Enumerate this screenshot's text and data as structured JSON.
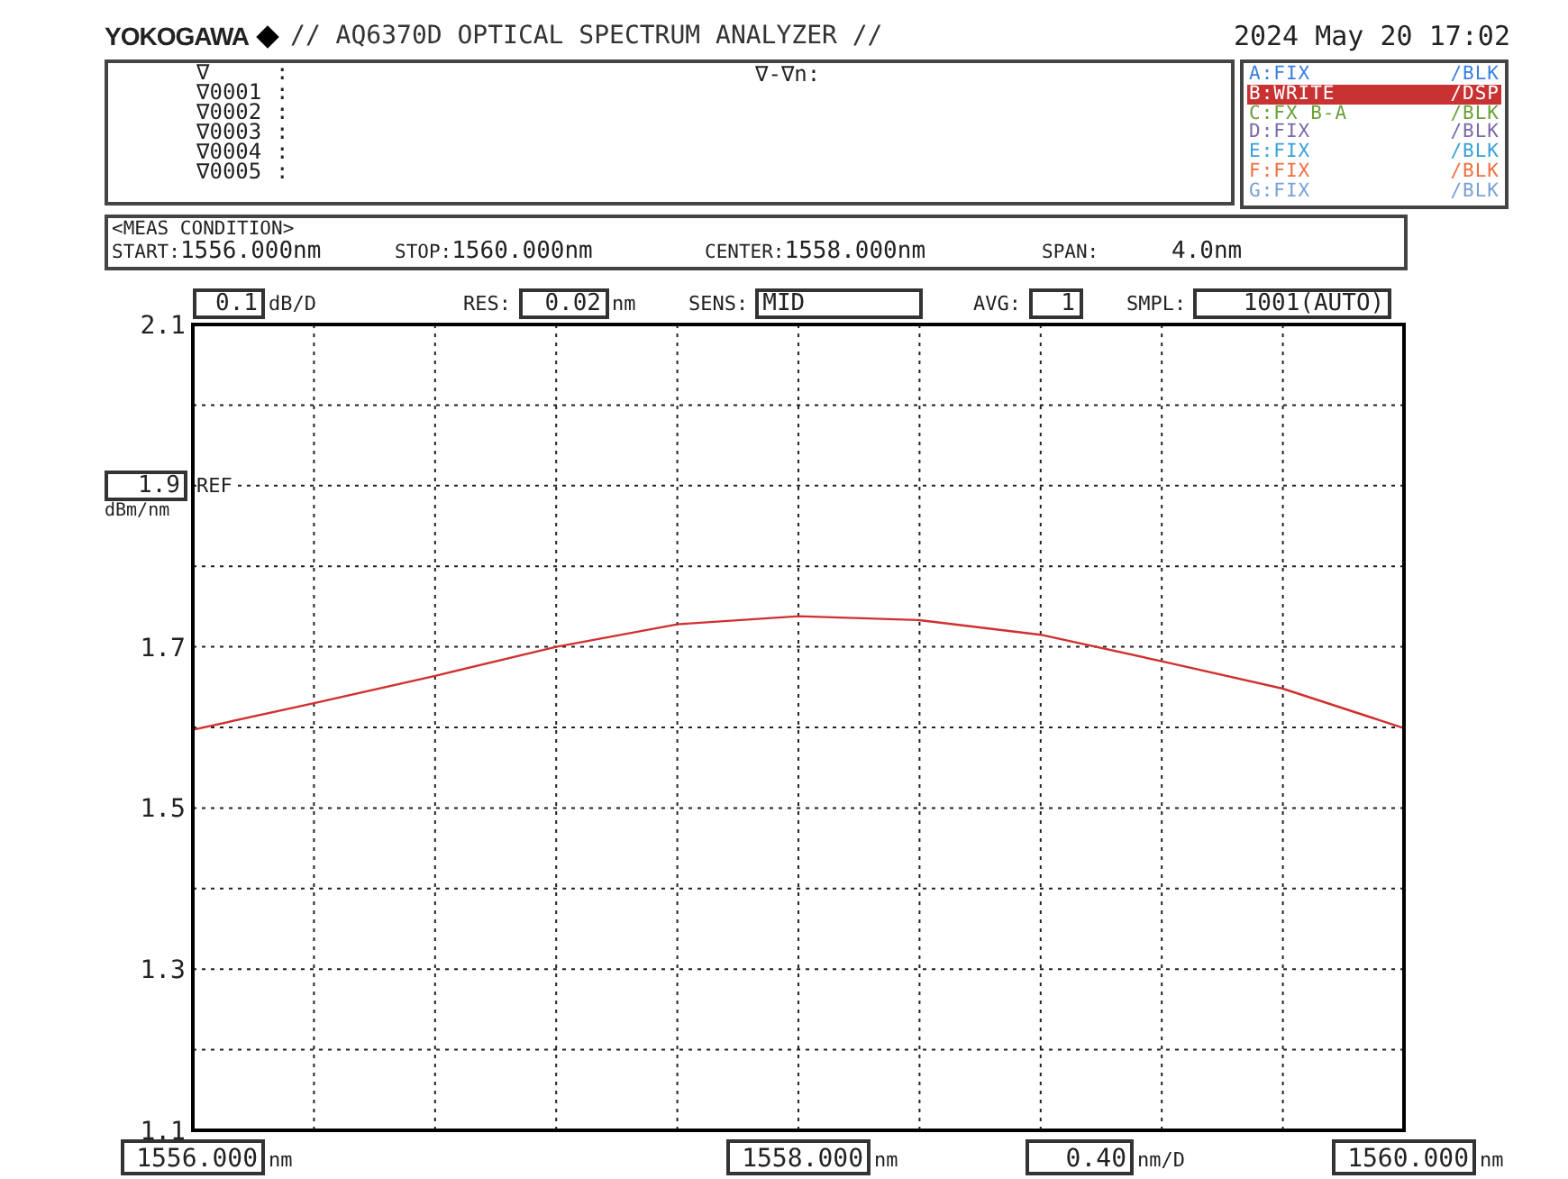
{
  "header": {
    "brand": "YOKOGAWA",
    "title": "// AQ6370D OPTICAL SPECTRUM ANALYZER //",
    "datetime": "2024 May 20 17:02"
  },
  "markers": [
    {
      "label": "∇",
      "sep": ":"
    },
    {
      "label": "∇0001",
      "sep": ":"
    },
    {
      "label": "∇0002",
      "sep": ":"
    },
    {
      "label": "∇0003",
      "sep": ":"
    },
    {
      "label": "∇0004",
      "sep": ":"
    },
    {
      "label": "∇0005",
      "sep": ":"
    }
  ],
  "delta_label": "∇-∇n:",
  "traces": [
    {
      "label": "A:FIX",
      "mode": "/BLK",
      "color": "#3a7fe0",
      "selected": false
    },
    {
      "label": "B:WRITE",
      "mode": "/DSP",
      "color": "#c83232",
      "selected": true
    },
    {
      "label": "C:FX B-A",
      "mode": "/BLK",
      "color": "#6aa03a",
      "selected": false
    },
    {
      "label": "D:FIX",
      "mode": "/BLK",
      "color": "#7a6aa8",
      "selected": false
    },
    {
      "label": "E:FIX",
      "mode": "/BLK",
      "color": "#3aa0d8",
      "selected": false
    },
    {
      "label": "F:FIX",
      "mode": "/BLK",
      "color": "#f07040",
      "selected": false
    },
    {
      "label": "G:FIX",
      "mode": "/BLK",
      "color": "#7aa0d8",
      "selected": false
    }
  ],
  "meas_condition": {
    "title": "<MEAS CONDITION>",
    "fields": [
      {
        "label": "START:",
        "value": "1556.000nm"
      },
      {
        "label": "STOP:",
        "value": "1560.000nm"
      },
      {
        "label": "CENTER:",
        "value": "1558.000nm"
      },
      {
        "label": "SPAN:",
        "value": "4.0nm"
      }
    ]
  },
  "settings": [
    {
      "kind": "number",
      "value": "0.1",
      "unit": "dB/D"
    },
    {
      "kind": "number",
      "label": "RES:",
      "value": "0.02",
      "unit": "nm"
    },
    {
      "kind": "text",
      "label": "SENS:",
      "value": "MID"
    },
    {
      "kind": "number",
      "label": "AVG:",
      "value": "1"
    },
    {
      "kind": "number",
      "label": "SMPL:",
      "value": "1001(AUTO)"
    }
  ],
  "reference": {
    "value": "1.9",
    "label": "REF",
    "unit": "dBm/nm"
  },
  "chart_data": {
    "type": "line",
    "x": [
      1556.0,
      1556.4,
      1556.8,
      1557.2,
      1557.6,
      1558.0,
      1558.4,
      1558.8,
      1559.2,
      1559.6,
      1560.0
    ],
    "series": [
      {
        "color": "#d03030",
        "values": [
          1.597,
          1.63,
          1.664,
          1.7,
          1.728,
          1.738,
          1.733,
          1.715,
          1.682,
          1.648,
          1.599
        ]
      }
    ],
    "grid": true,
    "xlim": [
      1556,
      1560
    ],
    "ylim": [
      1.1,
      2.1
    ],
    "yticks": [
      2.1,
      1.7,
      1.5,
      1.3,
      1.1
    ],
    "xticks": [
      {
        "value": 1556,
        "label": "1556.000"
      },
      {
        "value": 1558,
        "label": "1558.000"
      },
      {
        "value": 1560,
        "label": "1560.000"
      }
    ]
  },
  "x_units": [
    "nm",
    "nm",
    "nm"
  ],
  "per_division": {
    "value": "0.40",
    "unit": "nm/D"
  }
}
